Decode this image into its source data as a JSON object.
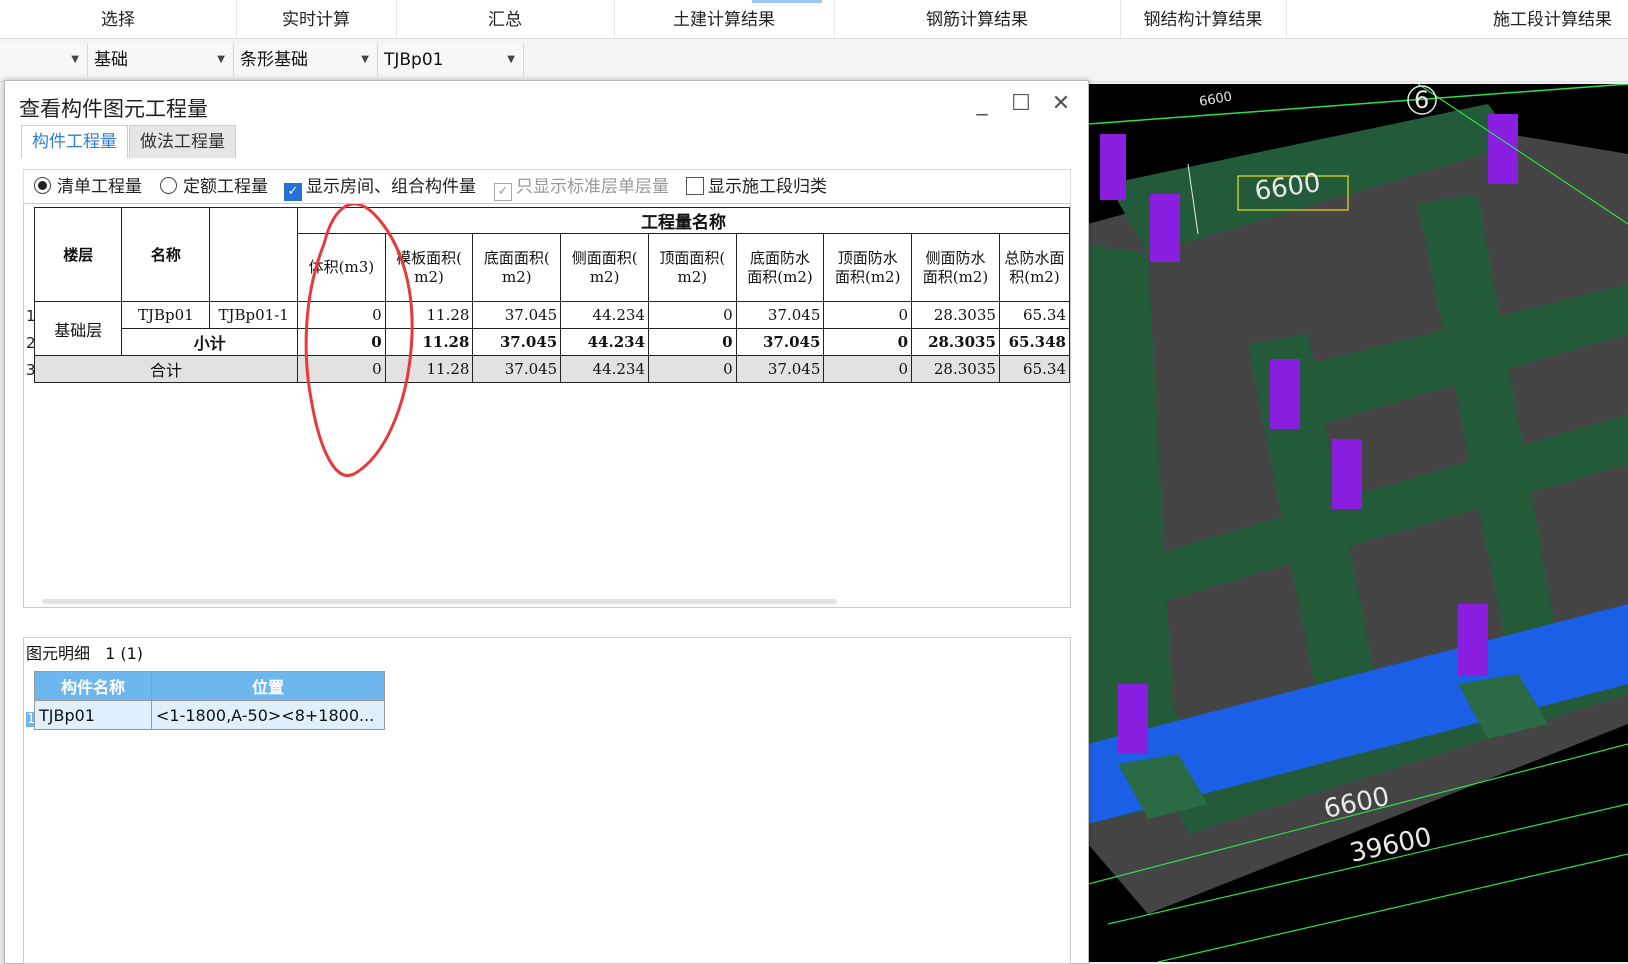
{
  "ribbon": {
    "items": [
      "选择",
      "实时计算",
      "汇总",
      "土建计算结果",
      "钢筋计算结果",
      "钢结构计算结果",
      "施工段计算结果"
    ]
  },
  "selectors": {
    "s0": "",
    "s1": "基础",
    "s2": "条形基础",
    "s3": "TJBp01"
  },
  "dialog": {
    "title": "查看构件图元工程量",
    "tabs": [
      "构件工程量",
      "做法工程量"
    ],
    "options": {
      "radio1": "清单工程量",
      "radio2": "定额工程量",
      "chk1": "显示房间、组合构件量",
      "chk2": "只显示标准层单层量",
      "chk3": "显示施工段归类"
    },
    "table": {
      "col_floor": "楼层",
      "col_name": "名称",
      "group_header": "工程量名称",
      "columns": [
        "体积(m3)",
        "模板面积(m2)",
        "底面面积(m2)",
        "侧面面积(m2)",
        "顶面面积(m2)",
        "底面防水面积(m2)",
        "顶面防水面积(m2)",
        "侧面防水面积(m2)",
        "总防水面积(m2)"
      ],
      "col_labels": [
        [
          "体积(m3)",
          ""
        ],
        [
          "模板面积(",
          "m2)"
        ],
        [
          "底面面积(",
          "m2)"
        ],
        [
          "侧面面积(",
          "m2)"
        ],
        [
          "顶面面积(",
          "m2)"
        ],
        [
          "底面防水",
          "面积(m2)"
        ],
        [
          "顶面防水",
          "面积(m2)"
        ],
        [
          "侧面防水",
          "面积(m2)"
        ],
        [
          "总防水面",
          "积(m2)"
        ]
      ],
      "row_numbers": [
        "1",
        "2",
        "3"
      ],
      "floor": "基础层",
      "name": "TJBp01",
      "sub_name": "TJBp01-1",
      "subtotal_label": "小计",
      "total_label": "合计",
      "row1": [
        "0",
        "11.28",
        "37.045",
        "44.234",
        "0",
        "37.045",
        "0",
        "28.3035",
        "65.34"
      ],
      "row2": [
        "0",
        "11.28",
        "37.045",
        "44.234",
        "0",
        "37.045",
        "0",
        "28.3035",
        "65.348"
      ],
      "row3": [
        "0",
        "11.28",
        "37.045",
        "44.234",
        "0",
        "37.045",
        "0",
        "28.3035",
        "65.34"
      ]
    },
    "details": {
      "title": "图元明细",
      "count": "1 (1)",
      "headers": [
        "构件名称",
        "位置"
      ],
      "rows": [
        {
          "no": "1",
          "name": "TJBp01",
          "pos": "<1-1800,A-50><8+1800..."
        }
      ]
    }
  },
  "cad": {
    "labels": [
      "6600",
      "6",
      "6600",
      "6600",
      "39600"
    ]
  }
}
